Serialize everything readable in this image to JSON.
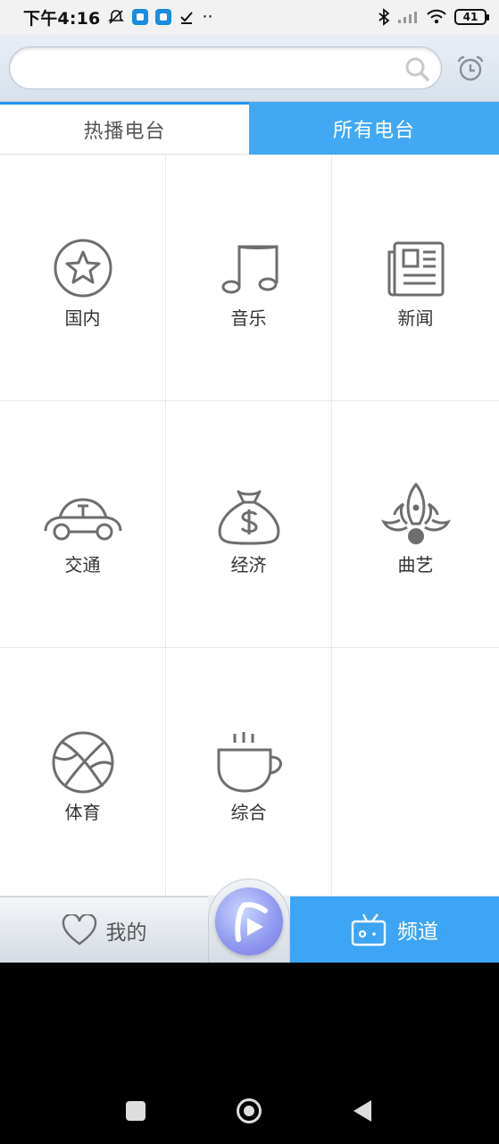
{
  "status_bar": {
    "time": "下午4:16",
    "extra": "··",
    "battery": "41"
  },
  "search": {
    "placeholder": "",
    "value": ""
  },
  "tabs": [
    {
      "label": "热播电台",
      "active": false
    },
    {
      "label": "所有电台",
      "active": true
    }
  ],
  "categories": [
    {
      "label": "国内",
      "icon": "star-circle-icon"
    },
    {
      "label": "音乐",
      "icon": "music-note-icon"
    },
    {
      "label": "新闻",
      "icon": "newspaper-icon"
    },
    {
      "label": "交通",
      "icon": "car-icon"
    },
    {
      "label": "经济",
      "icon": "money-bag-icon"
    },
    {
      "label": "曲艺",
      "icon": "lotus-icon"
    },
    {
      "label": "体育",
      "icon": "basketball-icon"
    },
    {
      "label": "综合",
      "icon": "coffee-cup-icon"
    }
  ],
  "bottom_nav": {
    "mine_label": "我的",
    "channel_label": "频道"
  },
  "colors": {
    "accent": "#42a8f4",
    "icon_gray": "#6e6e6e"
  }
}
